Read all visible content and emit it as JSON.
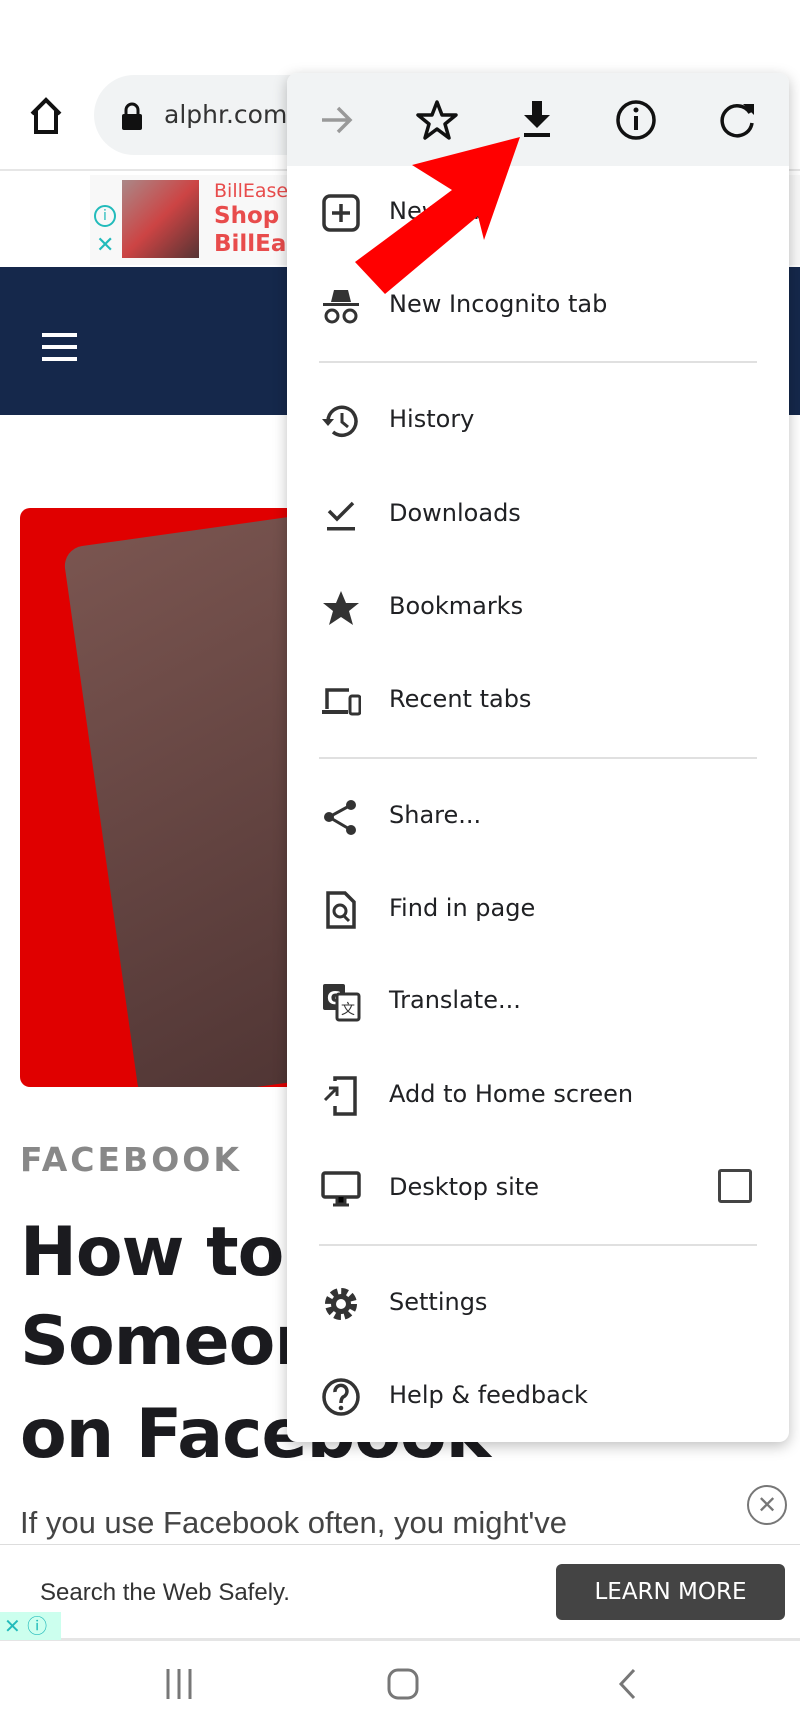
{
  "browser": {
    "url": "alphr.com"
  },
  "ad_top": {
    "brand": "BillEase",
    "line1": "Shop \"",
    "line2": "BillEas"
  },
  "article": {
    "category": "FACEBOOK",
    "title_lines": [
      "How to C",
      "Someon",
      "on Facebook"
    ],
    "intro": "If you use Facebook often, you might've"
  },
  "ad_bottom": {
    "text": "Search the Web Safely.",
    "button": "LEARN MORE"
  },
  "menu": {
    "toolbar": [
      "forward-icon",
      "bookmark-star-icon",
      "download-icon",
      "info-icon",
      "reload-icon"
    ],
    "items": [
      {
        "label": "New tab",
        "icon": "new-tab-icon"
      },
      {
        "label": "New Incognito tab",
        "icon": "incognito-icon"
      },
      {
        "label": "History",
        "icon": "history-icon"
      },
      {
        "label": "Downloads",
        "icon": "downloads-icon"
      },
      {
        "label": "Bookmarks",
        "icon": "star-icon"
      },
      {
        "label": "Recent tabs",
        "icon": "devices-icon"
      },
      {
        "label": "Share...",
        "icon": "share-icon"
      },
      {
        "label": "Find in page",
        "icon": "find-icon"
      },
      {
        "label": "Translate...",
        "icon": "translate-icon"
      },
      {
        "label": "Add to Home screen",
        "icon": "add-home-icon"
      },
      {
        "label": "Desktop site",
        "icon": "desktop-icon",
        "checked": false
      },
      {
        "label": "Settings",
        "icon": "gear-icon"
      },
      {
        "label": "Help & feedback",
        "icon": "help-icon"
      }
    ]
  },
  "colors": {
    "navy": "#15284b",
    "arrow": "#ff0000",
    "ad_red": "#e84c4c"
  }
}
